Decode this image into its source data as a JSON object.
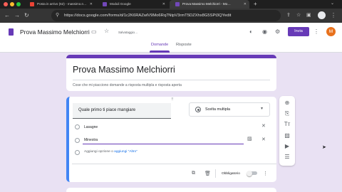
{
  "browser": {
    "tabs": [
      {
        "label": "Posta in arrivo (62) - massimo.n…",
        "icon_color": "#ea4335",
        "active": false
      },
      {
        "label": "Moduli Google",
        "icon_color": "#7248b9",
        "active": false
      },
      {
        "label": "Prova Massimo Melchiorri - Mo…",
        "icon_color": "#7248b9",
        "active": true
      }
    ],
    "new_tab": "+",
    "url": "https://docs.google.com/forms/d/1c2K6RAZwlV9Mo6Rq7NtpV3rmT5DZXhx8G5SPt3QYedit",
    "nav_icons": [
      "back-icon",
      "forward-icon",
      "reload-icon"
    ]
  },
  "form_header": {
    "title": "Prova Massimo Melchiorri",
    "saving_status": "Salvataggio…",
    "send_button": "Invia",
    "avatar_letter": "M"
  },
  "form_tabs": [
    {
      "label": "Domande",
      "active": true
    },
    {
      "label": "Risposte",
      "active": false
    }
  ],
  "form_card": {
    "title": "Prova Massimo Melchiorri",
    "description": "Cose che mi piacciono domande a risposta multipla e risposta aperta"
  },
  "question": {
    "text": "Quale primo ti piace mangiare",
    "type": "Scelta multipla",
    "options": [
      "Lasagne",
      "Minestra"
    ],
    "add_option": "Aggiungi opzione",
    "or_label": "o",
    "add_other": "aggiungi \"Altro\"",
    "required_label": "Obbligatorio"
  },
  "colors": {
    "accent": "#673ab7",
    "link": "#1a73e8",
    "question_border": "#4285f4",
    "page_bg": "#e9e1f3"
  }
}
